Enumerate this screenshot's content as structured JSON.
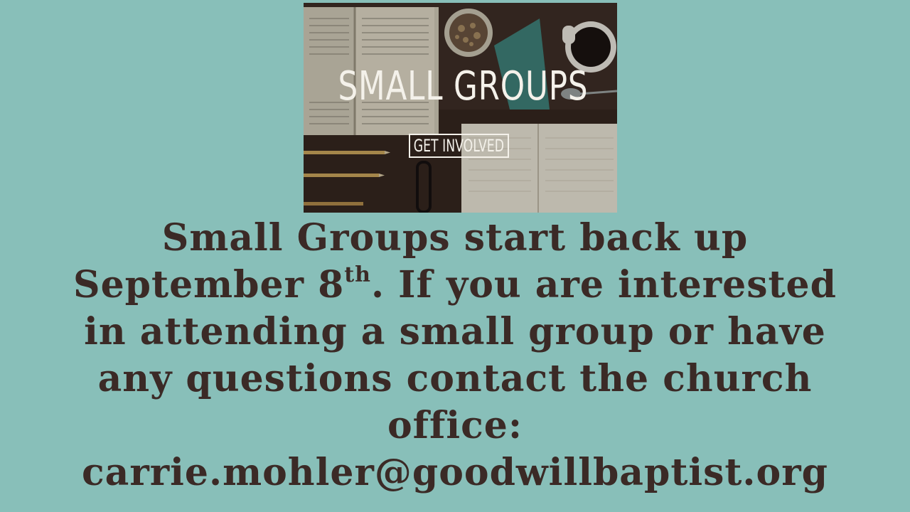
{
  "theme": {
    "background": "#88bfb9",
    "text": "#3b2a26"
  },
  "banner": {
    "title": "SMALL GROUPS",
    "cta": "GET INVOLVED"
  },
  "message": {
    "line1": "Small Groups start back up",
    "line2_pre": "September 8",
    "line2_sup": "th",
    "line2_post": ".  If you are interested",
    "line3": "in attending a small group or have",
    "line4": "any questions contact the church",
    "line5": "office:",
    "email": "carrie.mohler@goodwillbaptist.org"
  }
}
